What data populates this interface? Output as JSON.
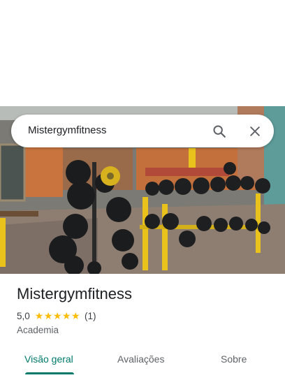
{
  "search": {
    "query": "Mistergymfitness",
    "search_icon": "search-icon",
    "close_icon": "close-icon"
  },
  "place": {
    "name": "Mistergymfitness",
    "rating": "5,0",
    "stars": "★★★★★",
    "reviews_count": "(1)",
    "category": "Academia"
  },
  "tabs": [
    {
      "label": "Visão geral",
      "active": true
    },
    {
      "label": "Avaliações",
      "active": false
    },
    {
      "label": "Sobre",
      "active": false
    }
  ],
  "colors": {
    "accent": "#00796b",
    "star": "#fbbc04"
  }
}
